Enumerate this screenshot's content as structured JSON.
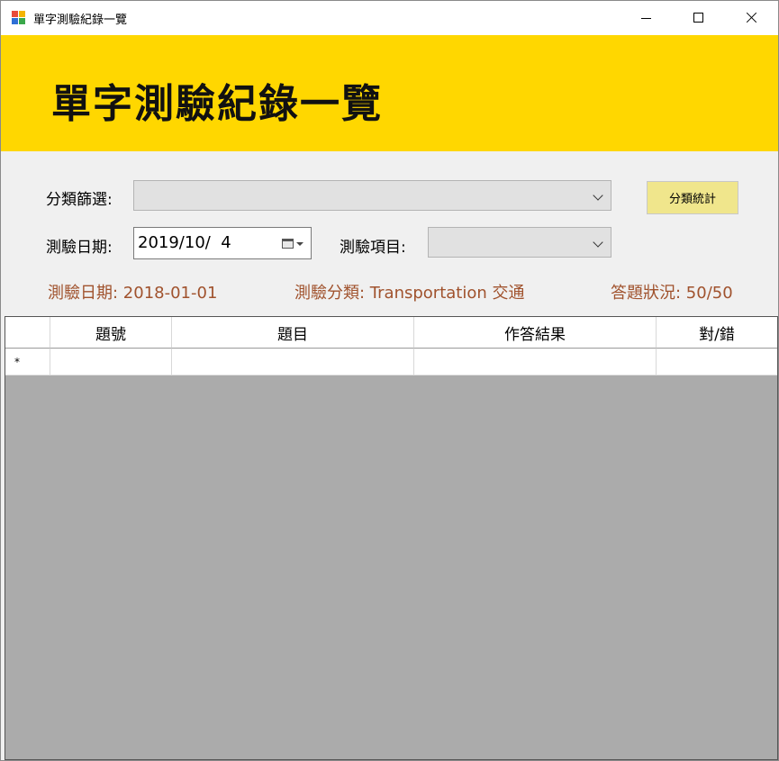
{
  "window": {
    "title": "單字測驗紀錄一覽",
    "icon_colors": [
      "#e84a3a",
      "#2f6fd6",
      "#f4b400",
      "#3aa84a"
    ]
  },
  "banner": {
    "title": "單字測驗紀錄一覽",
    "color": "#ffd700"
  },
  "form": {
    "category_filter_label": "分類篩選:",
    "category_filter_value": "",
    "stats_button_label": "分類統計",
    "date_label": "測驗日期:",
    "date_value": "2019/10/  4",
    "item_label": "測驗項目:",
    "item_value": ""
  },
  "info": {
    "test_date": "測驗日期: 2018-01-01",
    "test_category": "測驗分類: Transportation 交通",
    "answer_status": "答題狀況: 50/50",
    "color": "#a0522d"
  },
  "grid": {
    "columns": [
      "題號",
      "題目",
      "作答結果",
      "對/錯"
    ],
    "new_row_marker": "*"
  }
}
